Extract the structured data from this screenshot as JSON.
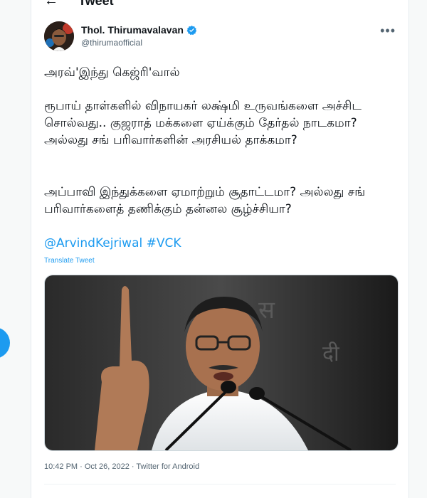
{
  "header": {
    "title": "Tweet"
  },
  "author": {
    "name": "Thol. Thirumavalavan",
    "handle": "@thirumaofficial"
  },
  "tweet": {
    "line1": "அரவ்'இந்து கெஜ்ரி'வால்",
    "para2": "ரூபாய் தாள்களில் விநாயகர் லக்ஷ்மி உருவங்களை அச்சிட சொல்வது.. குஜராத் மக்களை ஏய்க்கும் தேர்தல் நாடகமா? அல்லது சங் பரிவார்களின் அரசியல் தாக்கமா?",
    "para3": "அப்பாவி இந்துக்களை ஏமாற்றும் சூதாட்டமா? அல்லது சங் பரிவார்களைத் தணிக்கும் தன்னல சூழ்ச்சியா?",
    "tags": "@ArvindKejriwal #VCK",
    "translate": "Translate Tweet"
  },
  "meta": {
    "text": "10:42 PM · Oct 26, 2022 · Twitter for Android"
  },
  "colors": {
    "accent": "#1d9bf0",
    "secondary_text": "#536471"
  },
  "icons": {
    "back": "back-arrow-icon",
    "verified": "verified-badge-icon",
    "more": "more-options-icon"
  }
}
